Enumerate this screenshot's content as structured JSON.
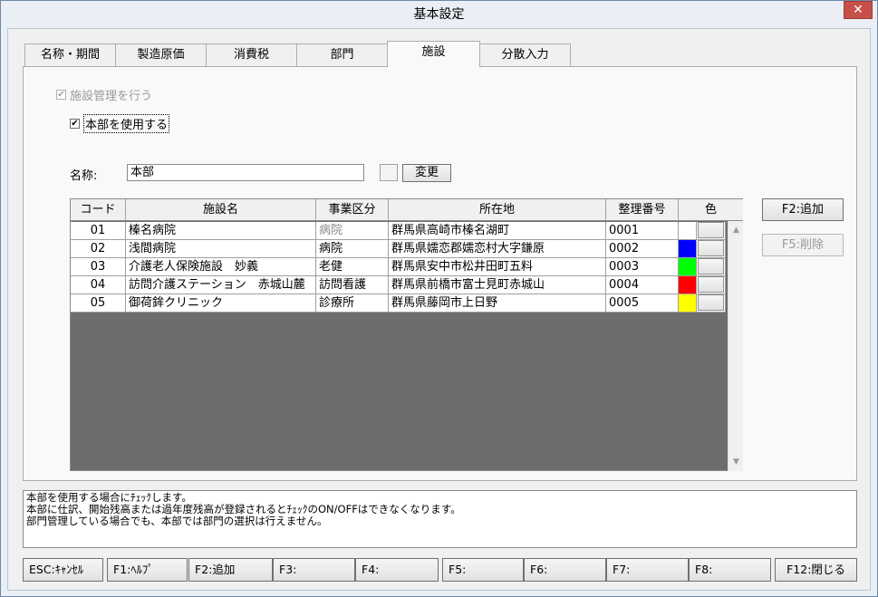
{
  "window": {
    "title": "基本設定",
    "close_symbol": "✕"
  },
  "tabs": [
    {
      "label": "名称・期間"
    },
    {
      "label": "製造原価"
    },
    {
      "label": "消費税"
    },
    {
      "label": "部門"
    },
    {
      "label": "施設",
      "active": true
    },
    {
      "label": "分散入力"
    }
  ],
  "facility_panel": {
    "manage_facility": {
      "label": "施設管理を行う",
      "checked": true,
      "enabled": false
    },
    "use_headquarters": {
      "label": "本部を使用する",
      "checked": true
    },
    "name_label": "名称:",
    "name_value": "本部",
    "change_button": "変更",
    "add_button": "F2:追加",
    "delete_button": "F5:削除"
  },
  "facility_table": {
    "columns": [
      "コード",
      "施設名",
      "事業区分",
      "所在地",
      "整理番号",
      "色"
    ],
    "rows": [
      {
        "code": "01",
        "name": "榛名病院",
        "category": "病院",
        "category_gray": true,
        "address": "群馬県高崎市榛名湖町",
        "ref_no": "0001",
        "color": "#ffffff"
      },
      {
        "code": "02",
        "name": "浅間病院",
        "category": "病院",
        "category_gray": false,
        "address": "群馬県嬬恋郡嬬恋村大字鎌原",
        "ref_no": "0002",
        "color": "#0000ff"
      },
      {
        "code": "03",
        "name": "介護老人保険施設　妙義",
        "category": "老健",
        "category_gray": false,
        "address": "群馬県安中市松井田町五料",
        "ref_no": "0003",
        "color": "#00ff00"
      },
      {
        "code": "04",
        "name": "訪問介護ステーション　赤城山麓",
        "category": "訪問看護",
        "category_gray": false,
        "address": "群馬県前橋市富士見町赤城山",
        "ref_no": "0004",
        "color": "#ff0000"
      },
      {
        "code": "05",
        "name": "御荷鉾クリニック",
        "category": "診療所",
        "category_gray": false,
        "address": "群馬県藤岡市上日野",
        "ref_no": "0005",
        "color": "#ffff00"
      }
    ]
  },
  "message": {
    "lines": [
      "本部を使用する場合にﾁｪｯｸします。",
      "本部に仕訳、開始残高または過年度残高が登録されるとﾁｪｯｸのON/OFFはできなくなります。",
      "部門管理している場合でも、本部では部門の選択は行えません。"
    ]
  },
  "function_keys": [
    "ESC:ｷｬﾝｾﾙ",
    "F1:ﾍﾙﾌﾟ",
    "F2:追加",
    "F3:",
    "F4:",
    "F5:",
    "F6:",
    "F7:",
    "F8:",
    "F12:閉じる"
  ]
}
